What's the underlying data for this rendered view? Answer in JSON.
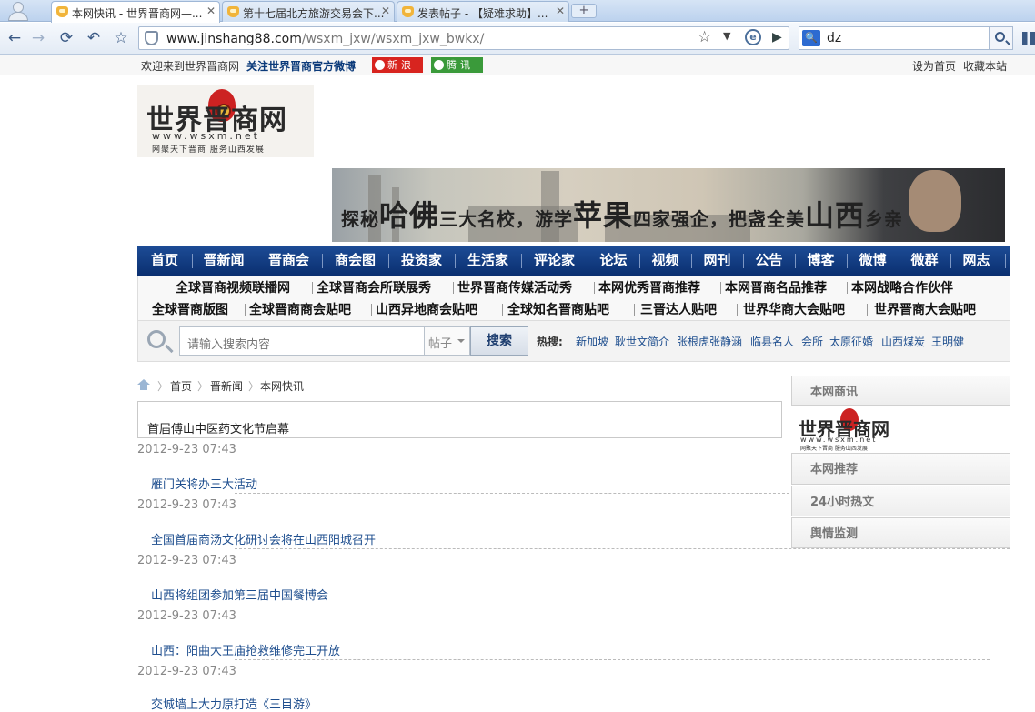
{
  "browser": {
    "tabs": [
      {
        "title": "本网快讯 - 世界晋商网—...",
        "active": true
      },
      {
        "title": "第十七届北方旅游交易会下..."
      },
      {
        "title": "发表帖子 - 【疑难求助】..."
      }
    ],
    "new_tab_symbol": "+",
    "url_domain": "www.jinshang88.com",
    "url_path": "/wsxm_jxw/wsxm_jxw_bwkx/",
    "search_value": "dz",
    "search_engine_glyph": "🔍"
  },
  "topbar": {
    "welcome": "欢迎来到世界晋商网",
    "follow": "关注世界晋商官方微博",
    "sina": "新浪",
    "qq": "腾讯",
    "set_home": "设为首页",
    "bookmark": "收藏本站"
  },
  "logo": {
    "title": "世界晋商网",
    "url": "www.wsxm.net",
    "slogan": "网聚天下晋商   服务山西发展"
  },
  "banner": {
    "text_parts": [
      "探秘",
      "哈佛",
      "三大名校，游学",
      "苹果",
      "四家强企，把盏全美",
      "山西",
      "乡亲"
    ]
  },
  "main_nav": [
    "首页",
    "晋新闻",
    "晋商会",
    "商会图",
    "投资家",
    "生活家",
    "评论家",
    "论坛",
    "视频",
    "网刊",
    "公告",
    "博客",
    "微博",
    "微群",
    "网志"
  ],
  "sub_nav": {
    "row1": [
      "全球晋商视频联播网",
      "全球晋商会所联展秀",
      "世界晋商传媒活动秀",
      "本网优秀晋商推荐",
      "本网晋商名品推荐",
      "本网战略合作伙伴"
    ],
    "row2": [
      "全球晋商版图",
      "全球晋商商会贴吧",
      "山西异地商会贴吧",
      "全球知名晋商贴吧",
      "三晋达人贴吧",
      "世界华商大会贴吧",
      "世界晋商大会贴吧"
    ]
  },
  "search": {
    "placeholder": "请输入搜索内容",
    "type": "帖子",
    "button": "搜索",
    "hot_label": "热搜:",
    "hot_terms": [
      "新加坡",
      "耿世文简介",
      "张根虎张静涵",
      "临县名人",
      "会所",
      "太原征婚",
      "山西煤炭",
      "王明健"
    ]
  },
  "breadcrumb": [
    "首页",
    "晋新闻",
    "本网快讯"
  ],
  "news": [
    {
      "title": "首届傅山中医药文化节启幕",
      "date": "2012-9-23 07:43"
    },
    {
      "title": "雁门关将办三大活动",
      "date": "2012-9-23 07:43"
    },
    {
      "title": "全国首届商汤文化研讨会将在山西阳城召开",
      "date": "2012-9-23 07:43"
    },
    {
      "title": "山西将组团参加第三届中国餐博会",
      "date": "2012-9-23 07:43"
    },
    {
      "title": "山西：阳曲大王庙抢救维修完工开放",
      "date": "2012-9-23 07:43"
    },
    {
      "title": "交城墙上大力原打造《三目游》",
      "date": ""
    }
  ],
  "sidebar": {
    "sections": [
      "本网商讯",
      "本网推荐",
      "24小时热文",
      "舆情监测"
    ]
  }
}
